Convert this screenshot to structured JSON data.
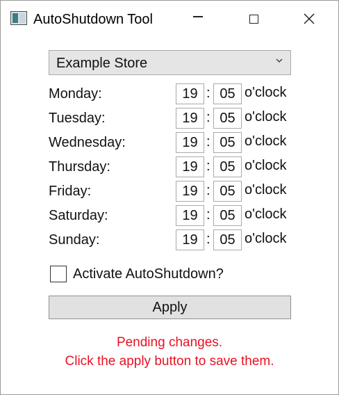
{
  "window": {
    "title": "AutoShutdown Tool",
    "icons": {
      "app": "app-icon",
      "minimize": "minimize-icon",
      "maximize": "maximize-icon",
      "close": "close-icon"
    }
  },
  "store_select": {
    "value": "Example Store",
    "icon": "chevron-down-icon"
  },
  "schedule": {
    "colon": ":",
    "unit": "o'clock",
    "days": [
      {
        "label": "Monday:",
        "hour": "19",
        "minute": "05"
      },
      {
        "label": "Tuesday:",
        "hour": "19",
        "minute": "05"
      },
      {
        "label": "Wednesday:",
        "hour": "19",
        "minute": "05"
      },
      {
        "label": "Thursday:",
        "hour": "19",
        "minute": "05"
      },
      {
        "label": "Friday:",
        "hour": "19",
        "minute": "05"
      },
      {
        "label": "Saturday:",
        "hour": "19",
        "minute": "05"
      },
      {
        "label": "Sunday:",
        "hour": "19",
        "minute": "05"
      }
    ]
  },
  "activate": {
    "label": "Activate AutoShutdown?",
    "checked": false
  },
  "apply_button": {
    "label": "Apply"
  },
  "status": {
    "line1": "Pending changes.",
    "line2": "Click the apply button to save them.",
    "color": "#e81123"
  },
  "colors": {
    "background": "#ffffff",
    "control_bg": "#e5e5e5",
    "border": "#a9a9a9"
  }
}
